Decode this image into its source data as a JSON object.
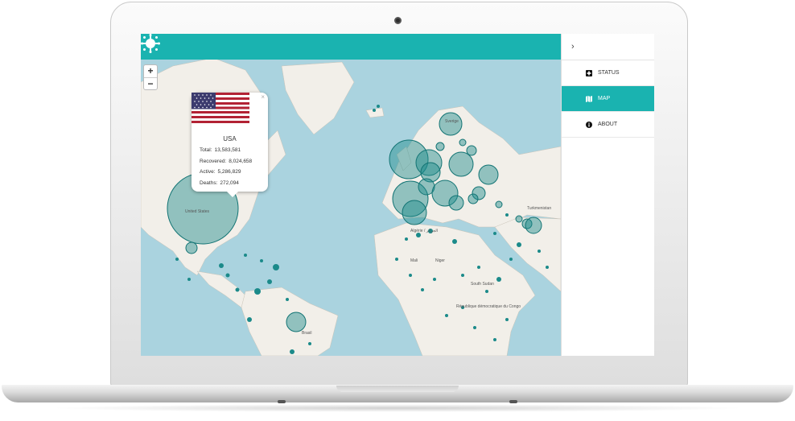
{
  "app": {
    "brand_icon": "virus-icon",
    "accent_color": "#1ab3b0"
  },
  "map": {
    "zoom_in": "+",
    "zoom_out": "−",
    "labels": {
      "united_states": "United States",
      "sverige": "Sverige",
      "algerie": "Algérie / الجزائر",
      "mali": "Mali",
      "niger": "Niger",
      "south_sudan": "South Sudan",
      "rep_congo": "République démocratique du Congo",
      "brasil": "Brasil",
      "turkmenistan": "Turkmenistan"
    }
  },
  "popup": {
    "country": "USA",
    "total_label": "Total:",
    "total_value": "13,583,581",
    "recovered_label": "Recovered:",
    "recovered_value": "8,024,658",
    "active_label": "Active:",
    "active_value": "5,286,829",
    "deaths_label": "Deaths:",
    "deaths_value": "272,094",
    "close": "×",
    "flag_icon": "usa-flag-icon"
  },
  "sidebar": {
    "toggle": "›",
    "items": [
      {
        "label": "STATUS",
        "icon": "plus-square-icon",
        "active": false
      },
      {
        "label": "MAP",
        "icon": "map-icon",
        "active": true
      },
      {
        "label": "ABOUT",
        "icon": "info-icon",
        "active": false
      }
    ]
  }
}
